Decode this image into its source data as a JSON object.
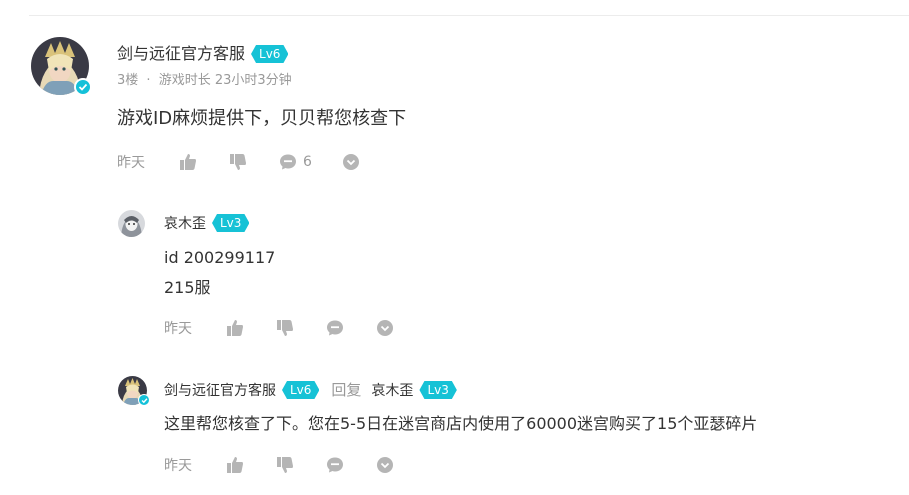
{
  "comment": {
    "author": "剑与远征官方客服",
    "level": "Lv6",
    "floor": "3楼",
    "separator": "·",
    "playtime": "游戏时长 23小时3分钟",
    "text": "游戏ID麻烦提供下，贝贝帮您核查下",
    "time": "昨天",
    "reply_count": "6"
  },
  "replies": [
    {
      "author": "哀木歪",
      "level": "Lv3",
      "lines": [
        "id 200299117",
        "215服"
      ],
      "time": "昨天"
    },
    {
      "author": "剑与远征官方客服",
      "level": "Lv6",
      "reply_word": "回复",
      "reply_to": "哀木歪",
      "reply_to_level": "Lv3",
      "text": "这里帮您核查了下。您在5-5日在迷宫商店内使用了60000迷宫购买了15个亚瑟碎片",
      "time": "昨天"
    }
  ],
  "colors": {
    "accent": "#16c2d6",
    "muted": "#9a9a9a",
    "text": "#333333"
  },
  "icons": [
    "thumbs-up-icon",
    "thumbs-down-icon",
    "comment-icon",
    "chevron-down-icon",
    "verified-icon"
  ]
}
